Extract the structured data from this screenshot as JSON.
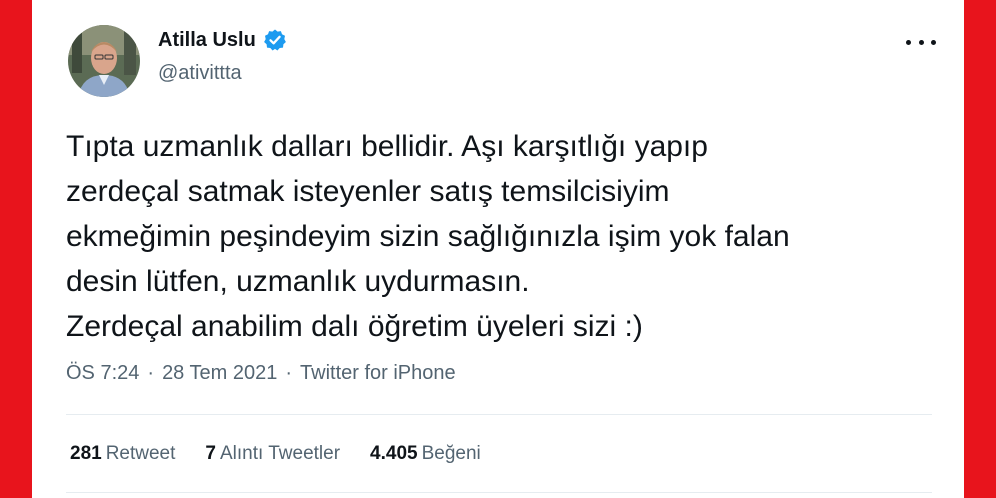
{
  "author": {
    "name": "Atilla Uslu",
    "handle": "@ativittta"
  },
  "tweet": {
    "text": "Tıpta uzmanlık dalları bellidir. Aşı karşıtlığı yapıp\nzerdeçal satmak isteyenler satış temsilcisiyim\nekmeğimin peşindeyim sizin sağlığınızla işim yok falan\ndesin lütfen, uzmanlık uydurmasın.\nZerdeçal anabilim dalı öğretim üyeleri sizi :)",
    "time": "ÖS 7:24",
    "date": "28 Tem 2021",
    "source": "Twitter for iPhone",
    "separator": "·"
  },
  "stats": {
    "retweets_count": "281",
    "retweets_label": "Retweet",
    "quotes_count": "7",
    "quotes_label": "Alıntı Tweetler",
    "likes_count": "4.405",
    "likes_label": "Beğeni"
  },
  "colors": {
    "background_frame": "#e8141c",
    "verified_badge": "#1d9bf0",
    "secondary_text": "#536471"
  },
  "icons": {
    "verified": "verified-badge-icon",
    "more": "more-options-icon"
  }
}
